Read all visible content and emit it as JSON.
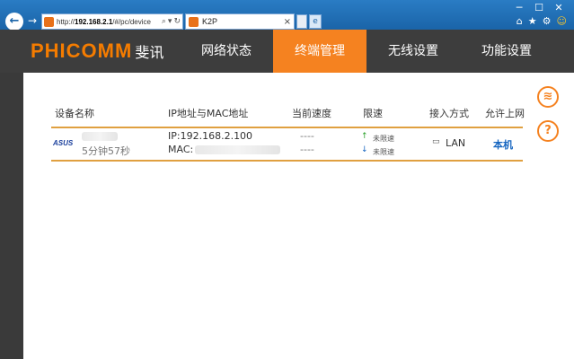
{
  "browser": {
    "url_prefix": "http://",
    "url_host": "192.168.2.1",
    "url_path": "/#/pc/device",
    "tab_title": "K2P"
  },
  "nav": {
    "logo_en": "PHICOMM",
    "logo_cn": "斐讯",
    "items": [
      {
        "label": "网络状态",
        "active": false
      },
      {
        "label": "终端管理",
        "active": true
      },
      {
        "label": "无线设置",
        "active": false
      },
      {
        "label": "功能设置",
        "active": false
      }
    ]
  },
  "table": {
    "headers": [
      "设备名称",
      "IP地址与MAC地址",
      "当前速度",
      "限速",
      "接入方式",
      "允许上网"
    ],
    "rows": [
      {
        "brand": "ASUS",
        "duration": "5分钟57秒",
        "ip": "IP:192.168.2.100",
        "mac_label": "MAC:",
        "speed_up": "----",
        "speed_down": "----",
        "limit_up": "未限速",
        "limit_down": "未限速",
        "access": "LAN",
        "allow": "本机"
      }
    ]
  },
  "colors": {
    "accent": "#f58220",
    "nav_bg": "#3d3d3d",
    "link": "#1565c0"
  }
}
